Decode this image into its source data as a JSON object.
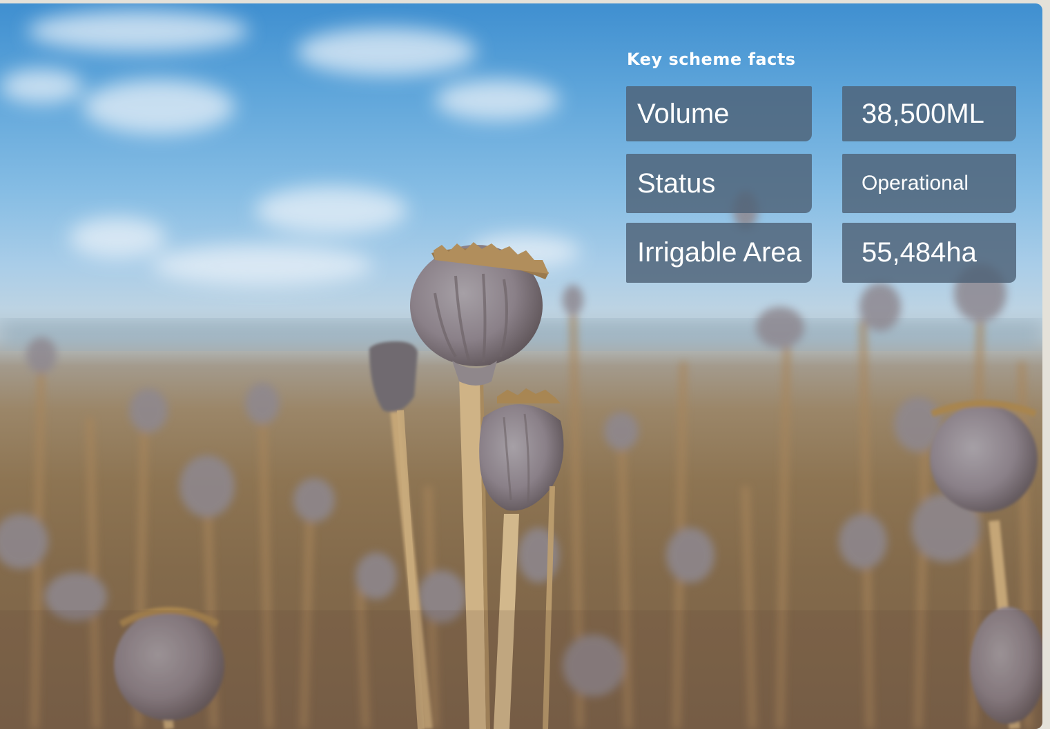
{
  "image": {
    "description_icon": "poppy-field-photo"
  },
  "key_facts": {
    "title": "Key scheme facts",
    "rows": [
      {
        "label": "Volume",
        "value": "38,500ML"
      },
      {
        "label": "Status",
        "value": "Operational"
      },
      {
        "label": "Irrigable Area",
        "value": "55,484ha"
      }
    ]
  },
  "colors": {
    "panel": "#4e6276",
    "text": "#ffffff",
    "sky": "#5ea5da",
    "field": "#8d7452"
  }
}
